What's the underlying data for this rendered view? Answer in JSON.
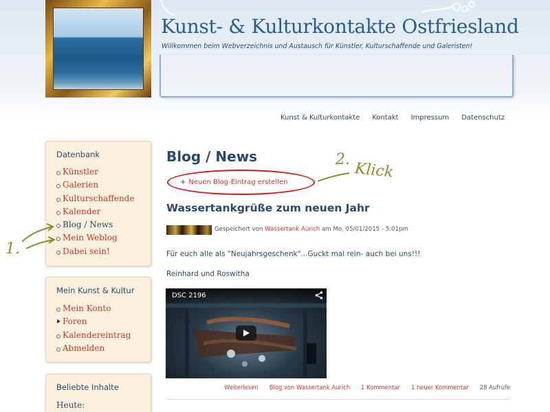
{
  "header": {
    "title": "Kunst- & Kulturkontakte Ostfriesland",
    "slogan": "Willkommen beim Webverzeichnis und Austausch für Künstler, Kulturschaffende und Galeristen!"
  },
  "topnav": [
    "Kunst & Kulturkontakte",
    "Kontakt",
    "Impressum",
    "Datenschutz"
  ],
  "sidebar": {
    "datenbank": {
      "title": "Datenbank",
      "items": [
        "Künstler",
        "Galerien",
        "Kulturschaffende",
        "Kalender",
        "Blog / News",
        "Mein Weblog",
        "Dabei sein!"
      ]
    },
    "meinkunst": {
      "title": "Mein Kunst & Kultur",
      "items": [
        "Mein Konto",
        "Foren",
        "Kalendereintrag",
        "Abmelden"
      ]
    },
    "beliebt": {
      "title": "Beliebte Inhalte",
      "heute": "Heute:"
    }
  },
  "main": {
    "page_title": "Blog / News",
    "create_plus": "+",
    "create_link": "Neuen Blog-Eintrag erstellen",
    "post_title": "Wassertankgrüße zum neuen Jahr",
    "meta_prefix": "Gespeichert von",
    "meta_author": "Wassertank Aurich",
    "meta_suffix": "am Mo, 05/01/2015 - 5:01pm",
    "paragraph1": "Für euch alle als \"Neujahrsgeschenk\"...Guckt mal rein- auch bei uns!!!",
    "paragraph2": "Reinhard und Roswitha",
    "video_title": "DSC 2196",
    "links": {
      "weiterlesen": "Weiterlesen",
      "blog": "Blog von Wassertank Aurich",
      "kommentar": "1 Kommentar",
      "neuer": "1 neuer Kommentar",
      "aufrufe": "28 Aufrufe"
    }
  },
  "annotations": {
    "step1": "1.",
    "step2": "2.",
    "klick": "Klick"
  },
  "colors": {
    "link_red": "#c0392b",
    "heading_blue": "#2a4a68",
    "sidebar_bg": "#fbf0de",
    "annotation_red": "#d41818",
    "annotation_olive": "#8a8a30"
  }
}
